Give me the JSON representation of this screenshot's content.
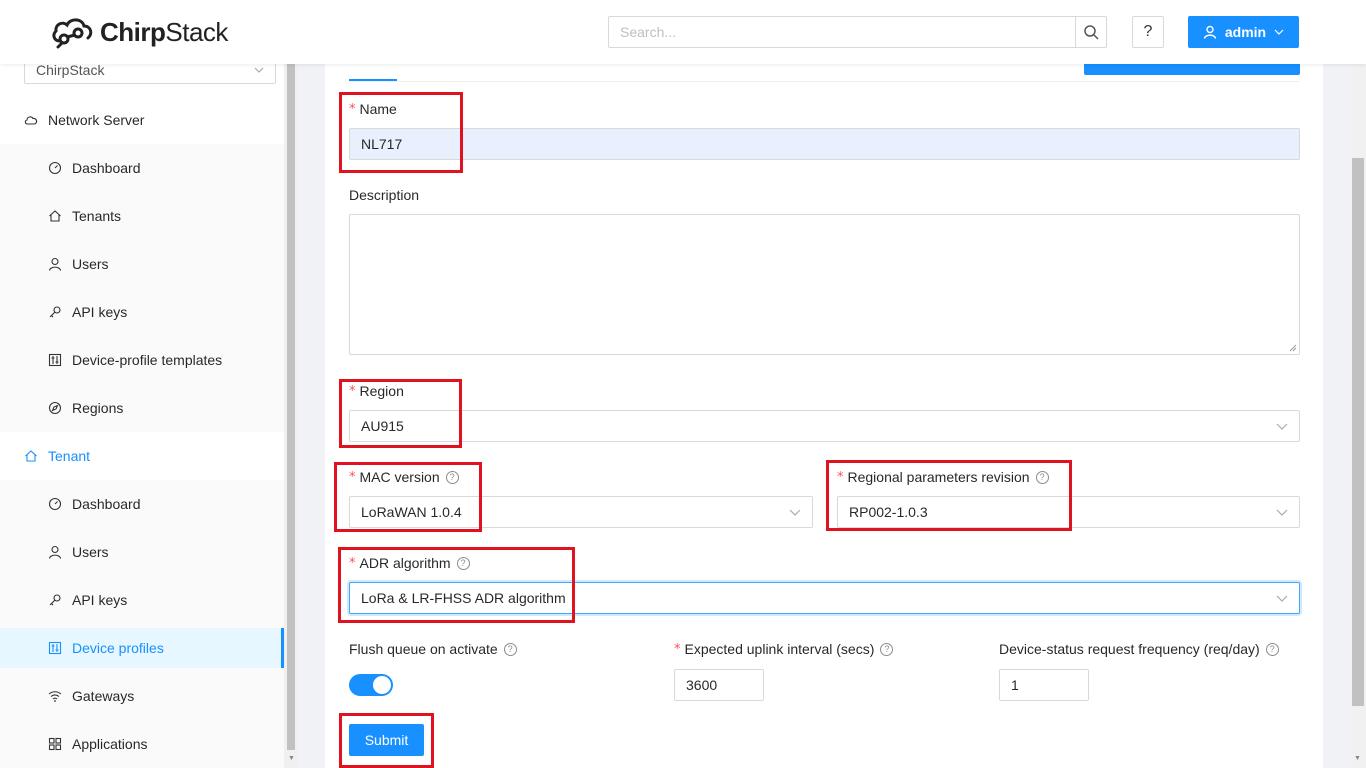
{
  "header": {
    "logo_text_bold": "Chirp",
    "logo_text_rest": "Stack",
    "search_placeholder": "Search...",
    "help_label": "?",
    "user_label": "admin"
  },
  "sidebar": {
    "tenant_select": "ChirpStack",
    "network_server": {
      "label": "Network Server",
      "items": [
        "Dashboard",
        "Tenants",
        "Users",
        "API keys",
        "Device-profile templates",
        "Regions"
      ]
    },
    "tenant": {
      "label": "Tenant",
      "items": [
        "Dashboard",
        "Users",
        "API keys",
        "Device profiles",
        "Gateways",
        "Applications"
      ],
      "selected": "Device profiles"
    }
  },
  "form": {
    "name_label": "Name",
    "name_value": "NL717",
    "description_label": "Description",
    "description_value": "",
    "region_label": "Region",
    "region_value": "AU915",
    "mac_version_label": "MAC version",
    "mac_version_value": "LoRaWAN 1.0.4",
    "regional_params_label": "Regional parameters revision",
    "regional_params_value": "RP002-1.0.3",
    "adr_label": "ADR algorithm",
    "adr_value": "LoRa & LR-FHSS ADR algorithm",
    "flush_queue_label": "Flush queue on activate",
    "flush_queue_on": true,
    "uplink_interval_label": "Expected uplink interval (secs)",
    "uplink_interval_value": "3600",
    "device_status_label": "Device-status request frequency (req/day)",
    "device_status_value": "1",
    "submit_label": "Submit"
  },
  "colors": {
    "primary": "#1890ff",
    "required": "#ff4d4f",
    "annotation": "#e0121f"
  }
}
